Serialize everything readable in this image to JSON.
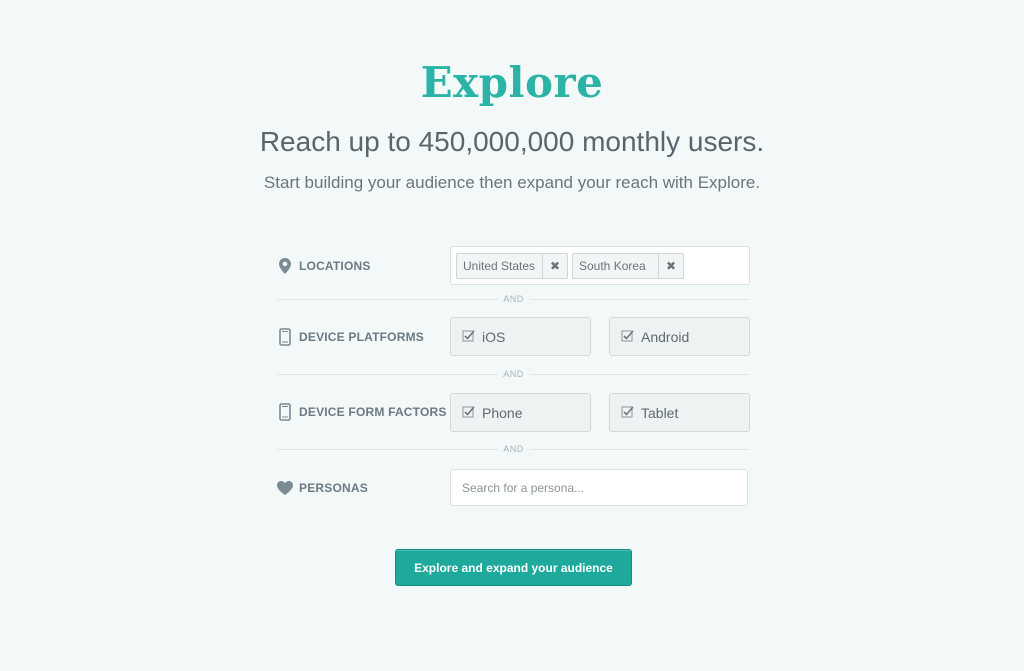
{
  "header": {
    "title": "Explore",
    "headline": "Reach up to 450,000,000 monthly users.",
    "subline": "Start building your audience then expand your reach with Explore."
  },
  "locations": {
    "label": "LOCATIONS",
    "icon": "map-pin-icon",
    "tags": [
      "United States",
      "South Korea"
    ]
  },
  "divider_text": "AND",
  "device_platforms": {
    "label": "DEVICE PLATFORMS",
    "icon": "mobile-device-icon",
    "options": [
      {
        "label": "iOS",
        "checked": true
      },
      {
        "label": "Android",
        "checked": true
      }
    ]
  },
  "device_form_factors": {
    "label": "DEVICE FORM FACTORS",
    "icon": "mobile-device-icon",
    "options": [
      {
        "label": "Phone",
        "checked": true
      },
      {
        "label": "Tablet",
        "checked": true
      }
    ]
  },
  "personas": {
    "label": "PERSONAS",
    "icon": "heart-icon",
    "placeholder": "Search for a persona..."
  },
  "cta": {
    "label": "Explore and expand your audience"
  },
  "colors": {
    "accent": "#2bb3a5",
    "button": "#1fa99d",
    "background": "#f3f8f9"
  }
}
